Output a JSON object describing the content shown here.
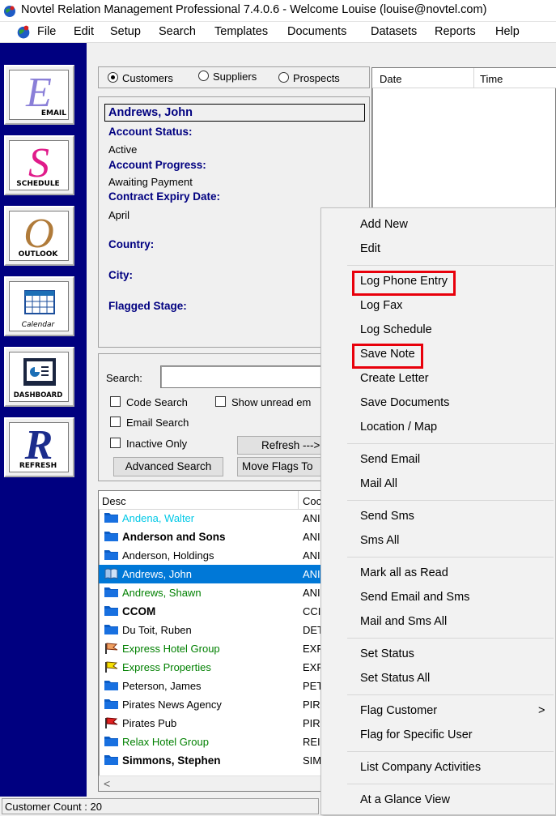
{
  "window": {
    "title": "Novtel Relation Management Professional 7.4.0.6 - Welcome Louise (louise@novtel.com)"
  },
  "menu": [
    "File",
    "Edit",
    "Setup",
    "Search",
    "Templates",
    "Documents",
    "Datasets",
    "Reports",
    "Help"
  ],
  "toolbar": [
    {
      "glyph": "E",
      "label": "EMAIL",
      "color": "#8a7fd8"
    },
    {
      "glyph": "S",
      "label": "SCHEDULE",
      "color": "#e01b8a"
    },
    {
      "glyph": "O",
      "label": "OUTLOOK",
      "color": "#b07b3a"
    },
    {
      "glyph": "",
      "label": "Calendar",
      "color": "#1c6fb6"
    },
    {
      "glyph": "",
      "label": "DASHBOARD",
      "color": "#1c6fb6"
    },
    {
      "glyph": "R",
      "label": "REFRESH",
      "color": "#1b2c8c"
    }
  ],
  "filter": {
    "options": [
      "Customers",
      "Suppliers",
      "Prospects"
    ],
    "selected": "Customers"
  },
  "detail": {
    "name": "Andrews, John",
    "account_status_label": "Account Status:",
    "account_status": "Active",
    "account_progress_label": "Account Progress:",
    "account_progress": "Awaiting Payment",
    "contract_expiry_label": "Contract Expiry Date:",
    "contract_expiry": "April",
    "country_label": "Country:",
    "city_label": "City:",
    "flagged_stage_label": "Flagged Stage:"
  },
  "activity": {
    "columns": [
      "Date",
      "Time"
    ]
  },
  "search": {
    "label": "Search:",
    "value": "",
    "code_search": "Code Search",
    "show_unread": "Show unread em",
    "email_search": "Email Search",
    "inactive_only": "Inactive Only",
    "refresh": "Refresh --->",
    "advanced": "Advanced Search",
    "move_flags": "Move Flags To"
  },
  "list": {
    "columns": [
      "Desc",
      "Coc"
    ],
    "rows": [
      {
        "desc": "Andena, Walter",
        "code": "ANI",
        "color": "#00c8e6",
        "bold": false,
        "icon": "folder"
      },
      {
        "desc": "Anderson and Sons",
        "code": "ANI",
        "color": "#000000",
        "bold": true,
        "icon": "folder"
      },
      {
        "desc": "Anderson, Holdings",
        "code": "ANI",
        "color": "#000000",
        "bold": false,
        "icon": "folder"
      },
      {
        "desc": "Andrews, John",
        "code": "ANI",
        "color": "#ffffff",
        "bold": false,
        "icon": "open-folder",
        "selected": true
      },
      {
        "desc": "Andrews, Shawn",
        "code": "ANI",
        "color": "#008000",
        "bold": false,
        "icon": "folder"
      },
      {
        "desc": "CCOM",
        "code": "CCI",
        "color": "#000000",
        "bold": true,
        "icon": "folder"
      },
      {
        "desc": "Du Toit, Ruben",
        "code": "DET",
        "color": "#000000",
        "bold": false,
        "icon": "folder"
      },
      {
        "desc": "Express Hotel Group",
        "code": "EXF",
        "color": "#008000",
        "bold": false,
        "icon": "flag-orange"
      },
      {
        "desc": "Express Properties",
        "code": "EXF",
        "color": "#008000",
        "bold": false,
        "icon": "flag-yellow"
      },
      {
        "desc": "Peterson, James",
        "code": "PET",
        "color": "#000000",
        "bold": false,
        "icon": "folder"
      },
      {
        "desc": "Pirates News Agency",
        "code": "PIR",
        "color": "#000000",
        "bold": false,
        "icon": "folder"
      },
      {
        "desc": "Pirates Pub",
        "code": "PIR",
        "color": "#000000",
        "bold": false,
        "icon": "flag-red"
      },
      {
        "desc": "Relax Hotel Group",
        "code": "REI",
        "color": "#008000",
        "bold": false,
        "icon": "folder"
      },
      {
        "desc": "Simmons, Stephen",
        "code": "SIM",
        "color": "#000000",
        "bold": true,
        "icon": "folder"
      }
    ]
  },
  "status": {
    "customer_count": "Customer Count : 20"
  },
  "context_menu": {
    "groups": [
      [
        "Add New",
        "Edit"
      ],
      [
        "Log Phone Entry",
        "Log Fax",
        "Log Schedule",
        "Save Note",
        "Create Letter",
        "Save Documents",
        "Location / Map"
      ],
      [
        "Send Email",
        "Mail All"
      ],
      [
        "Send Sms",
        "Sms All"
      ],
      [
        "Mark all as Read",
        "Send Email and Sms",
        "Mail and Sms All"
      ],
      [
        "Set Status",
        "Set Status All"
      ],
      [
        "Flag Customer",
        "Flag for Specific User"
      ],
      [
        "List Company Activities"
      ],
      [
        "At a Glance View"
      ]
    ],
    "submenu_arrow": ">",
    "highlighted": [
      "Log Phone Entry",
      "Save Note"
    ],
    "highlight_color": "#e8000b"
  }
}
